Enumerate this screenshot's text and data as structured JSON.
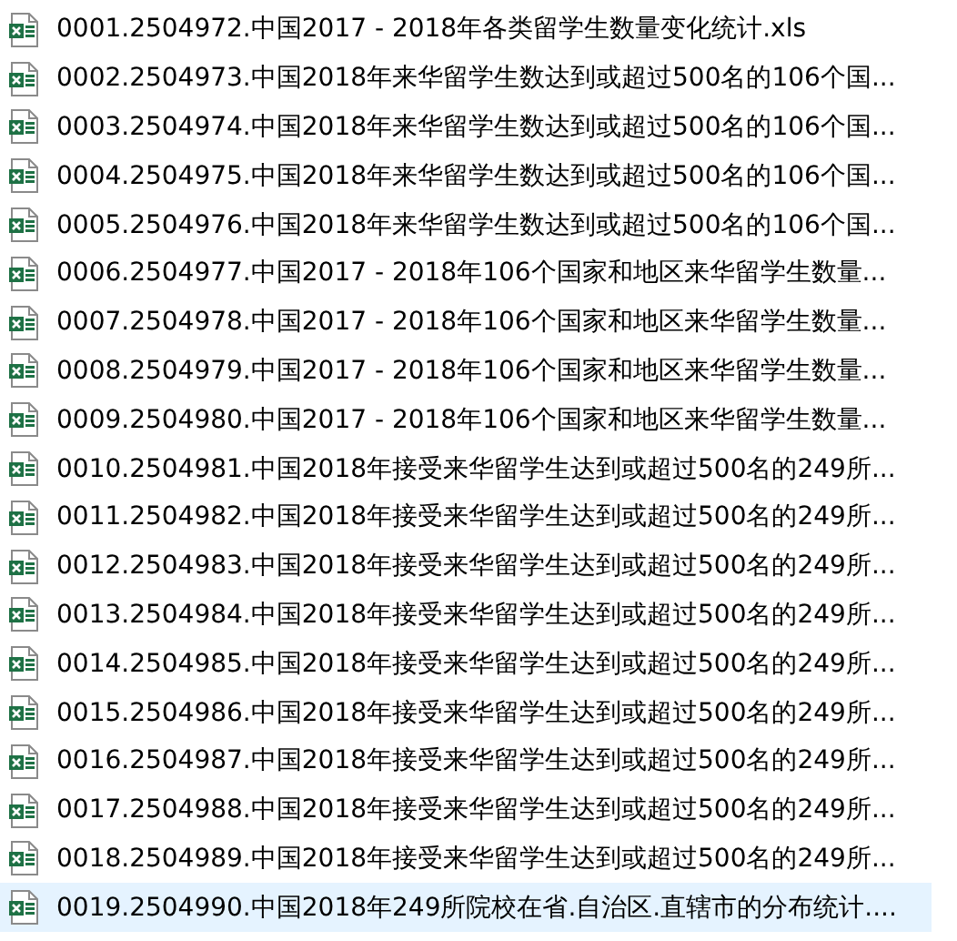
{
  "files": [
    {
      "name": "0001.2504972.中国2017 - 2018年各类留学生数量变化统计.xls",
      "selected": false
    },
    {
      "name": "0002.2504973.中国2018年来华留学生数达到或超过500名的106个国...",
      "selected": false
    },
    {
      "name": "0003.2504974.中国2018年来华留学生数达到或超过500名的106个国...",
      "selected": false
    },
    {
      "name": "0004.2504975.中国2018年来华留学生数达到或超过500名的106个国...",
      "selected": false
    },
    {
      "name": "0005.2504976.中国2018年来华留学生数达到或超过500名的106个国...",
      "selected": false
    },
    {
      "name": "0006.2504977.中国2017 - 2018年106个国家和地区来华留学生数量...",
      "selected": false
    },
    {
      "name": "0007.2504978.中国2017 - 2018年106个国家和地区来华留学生数量...",
      "selected": false
    },
    {
      "name": "0008.2504979.中国2017 - 2018年106个国家和地区来华留学生数量...",
      "selected": false
    },
    {
      "name": "0009.2504980.中国2017 - 2018年106个国家和地区来华留学生数量...",
      "selected": false
    },
    {
      "name": "0010.2504981.中国2018年接受来华留学生达到或超过500名的249所...",
      "selected": false
    },
    {
      "name": "0011.2504982.中国2018年接受来华留学生达到或超过500名的249所...",
      "selected": false
    },
    {
      "name": "0012.2504983.中国2018年接受来华留学生达到或超过500名的249所...",
      "selected": false
    },
    {
      "name": "0013.2504984.中国2018年接受来华留学生达到或超过500名的249所...",
      "selected": false
    },
    {
      "name": "0014.2504985.中国2018年接受来华留学生达到或超过500名的249所...",
      "selected": false
    },
    {
      "name": "0015.2504986.中国2018年接受来华留学生达到或超过500名的249所...",
      "selected": false
    },
    {
      "name": "0016.2504987.中国2018年接受来华留学生达到或超过500名的249所...",
      "selected": false
    },
    {
      "name": "0017.2504988.中国2018年接受来华留学生达到或超过500名的249所...",
      "selected": false
    },
    {
      "name": "0018.2504989.中国2018年接受来华留学生达到或超过500名的249所...",
      "selected": false
    },
    {
      "name": "0019.2504990.中国2018年249所院校在省.自治区.直辖市的分布统计....",
      "selected": true
    }
  ]
}
